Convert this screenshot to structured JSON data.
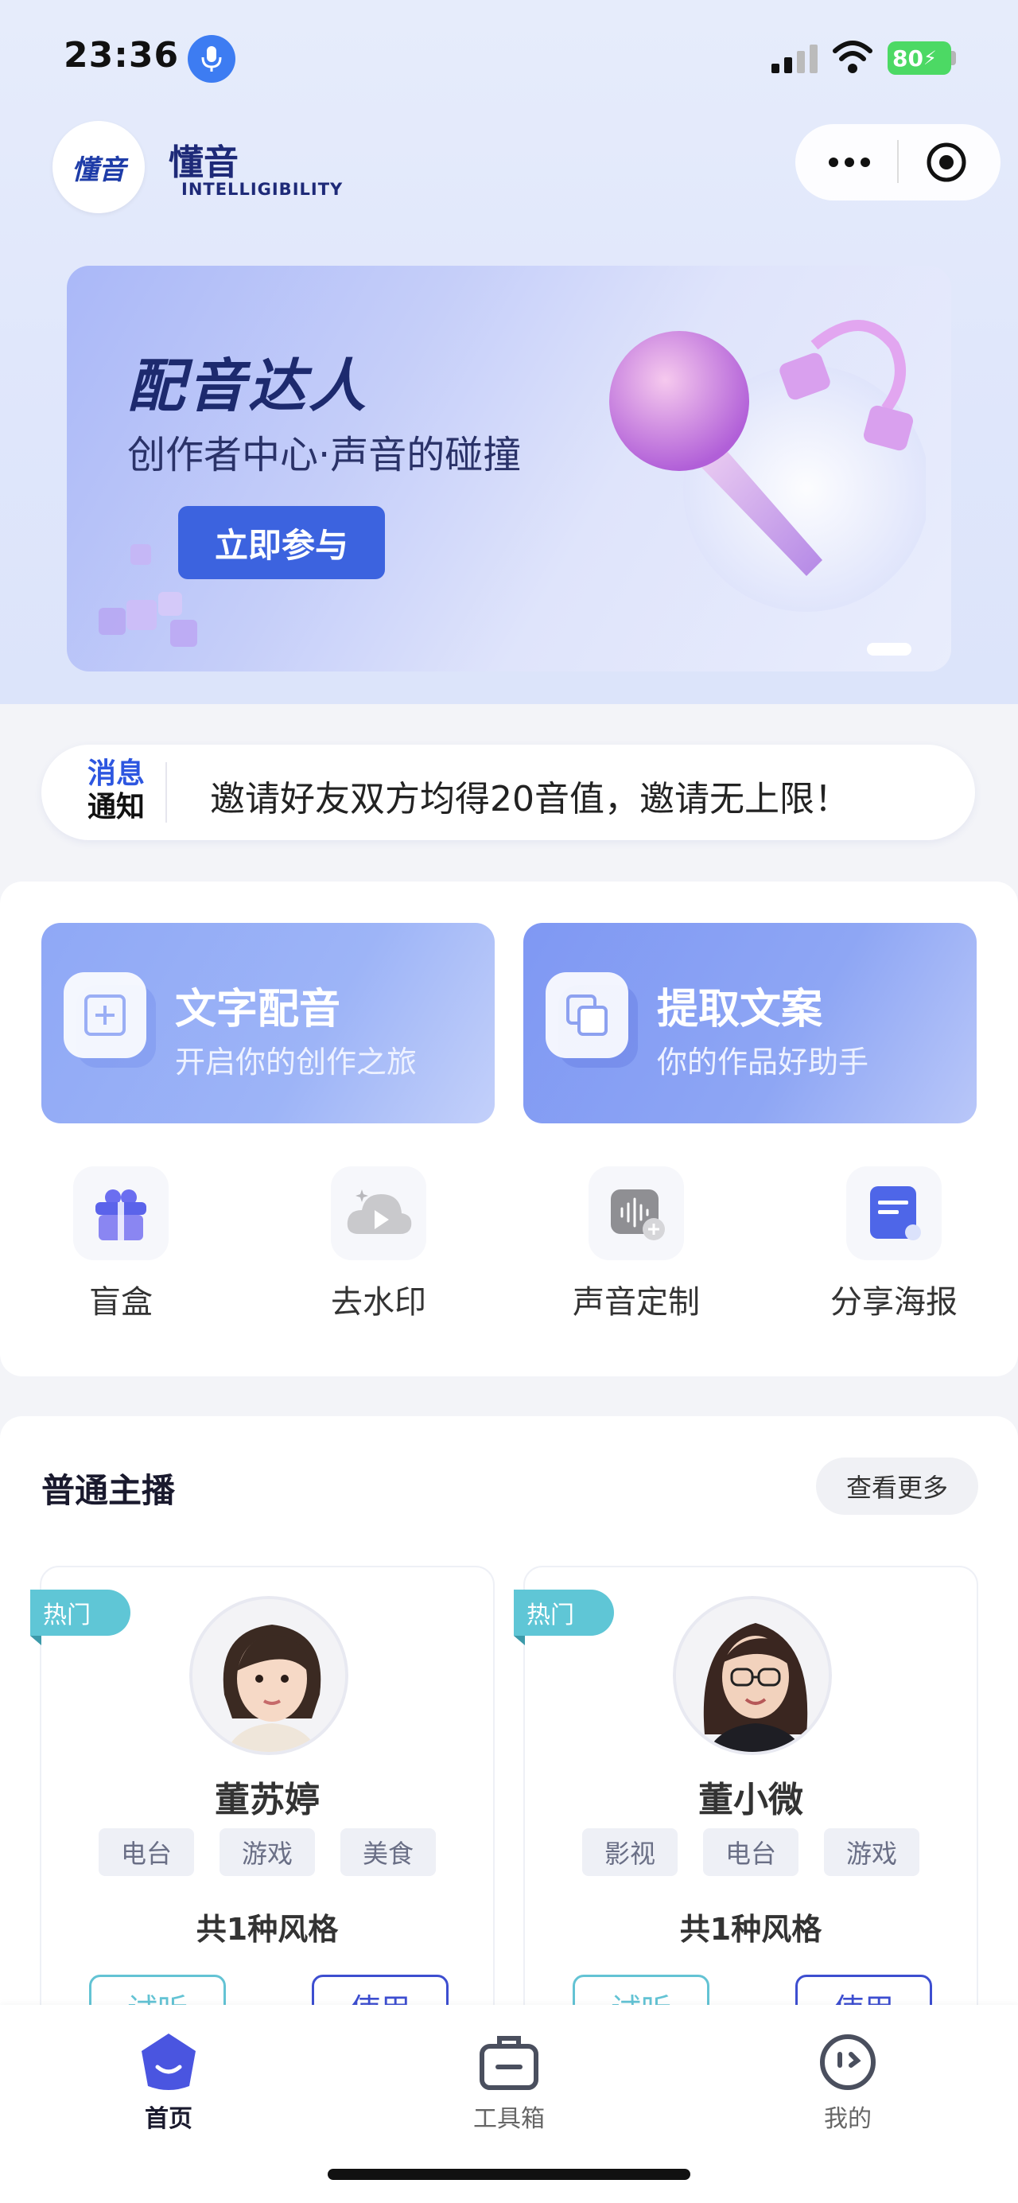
{
  "status_bar": {
    "time": "23:36",
    "battery": "80"
  },
  "header": {
    "logo_text": "懂音",
    "brand_cn": "懂音",
    "brand_en": "INTELLIGIBILITY"
  },
  "banner": {
    "title": "配音达人",
    "subtitle": "创作者中心·声音的碰撞",
    "cta": "立即参与"
  },
  "notice": {
    "badge_line1": "消息",
    "badge_line2": "通知",
    "text": "邀请好友双方均得20音值，邀请无上限！"
  },
  "features": {
    "primary": [
      {
        "title": "文字配音",
        "subtitle": "开启你的创作之旅"
      },
      {
        "title": "提取文案",
        "subtitle": "你的作品好助手"
      }
    ],
    "secondary": [
      {
        "label": "盲盒",
        "icon": "gift-box-icon"
      },
      {
        "label": "去水印",
        "icon": "cloud-video-icon"
      },
      {
        "label": "声音定制",
        "icon": "voice-custom-icon"
      },
      {
        "label": "分享海报",
        "icon": "poster-icon"
      }
    ]
  },
  "anchors": {
    "section_title": "普通主播",
    "more_label": "查看更多",
    "items": [
      {
        "badge": "热门",
        "name": "董苏婷",
        "tags": [
          "电台",
          "游戏",
          "美食"
        ],
        "styles": "共1种风格",
        "listen": "试听",
        "use": "使用"
      },
      {
        "badge": "热门",
        "name": "董小微",
        "tags": [
          "影视",
          "电台",
          "游戏"
        ],
        "styles": "共1种风格",
        "listen": "试听",
        "use": "使用"
      }
    ]
  },
  "tabbar": {
    "items": [
      {
        "label": "首页",
        "icon": "home-face-icon",
        "active": true
      },
      {
        "label": "工具箱",
        "icon": "toolbox-icon",
        "active": false
      },
      {
        "label": "我的",
        "icon": "profile-face-icon",
        "active": false
      }
    ]
  },
  "colors": {
    "accent": "#3c63df",
    "hot_badge": "#5fc6d6",
    "use_button": "#3d4ed0"
  }
}
